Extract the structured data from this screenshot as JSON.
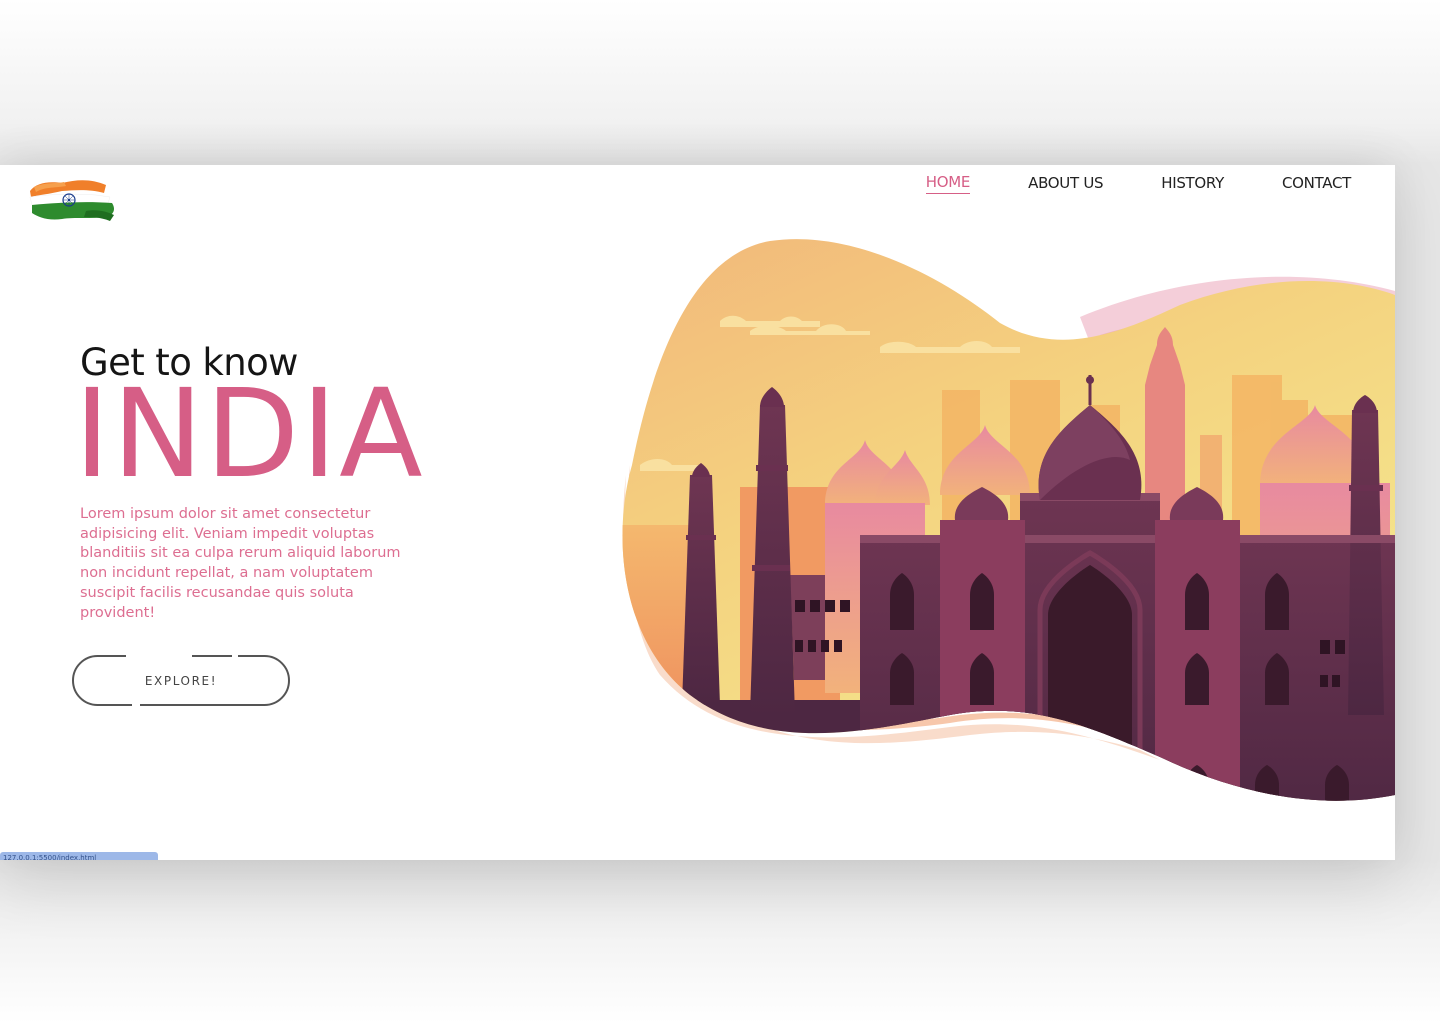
{
  "nav": {
    "items": [
      {
        "label": "HOME",
        "active": true
      },
      {
        "label": "ABOUT US",
        "active": false
      },
      {
        "label": "HISTORY",
        "active": false
      },
      {
        "label": "CONTACT",
        "active": false
      }
    ]
  },
  "logo": {
    "icon": "indian-flag-brushstroke-icon"
  },
  "hero": {
    "subtitle": "Get to know",
    "title": "INDIA",
    "body": "Lorem ipsum dolor sit amet consectetur adipisicing elit. Veniam impedit voluptas blanditiis sit ea culpa rerum aliquid laborum non incidunt repellat, a nam voluptatem suscipit facilis recusandae quis soluta provident!",
    "button_label": "EXPLORE!"
  },
  "colors": {
    "accent": "#d65e86",
    "text_dark": "#151515",
    "sky_top": "#f3c17a",
    "sky_bottom": "#f4e28d",
    "monument_dark": "#5c2f48"
  },
  "status_bar": {
    "text": "127.0.0.1:5500/index.html"
  }
}
